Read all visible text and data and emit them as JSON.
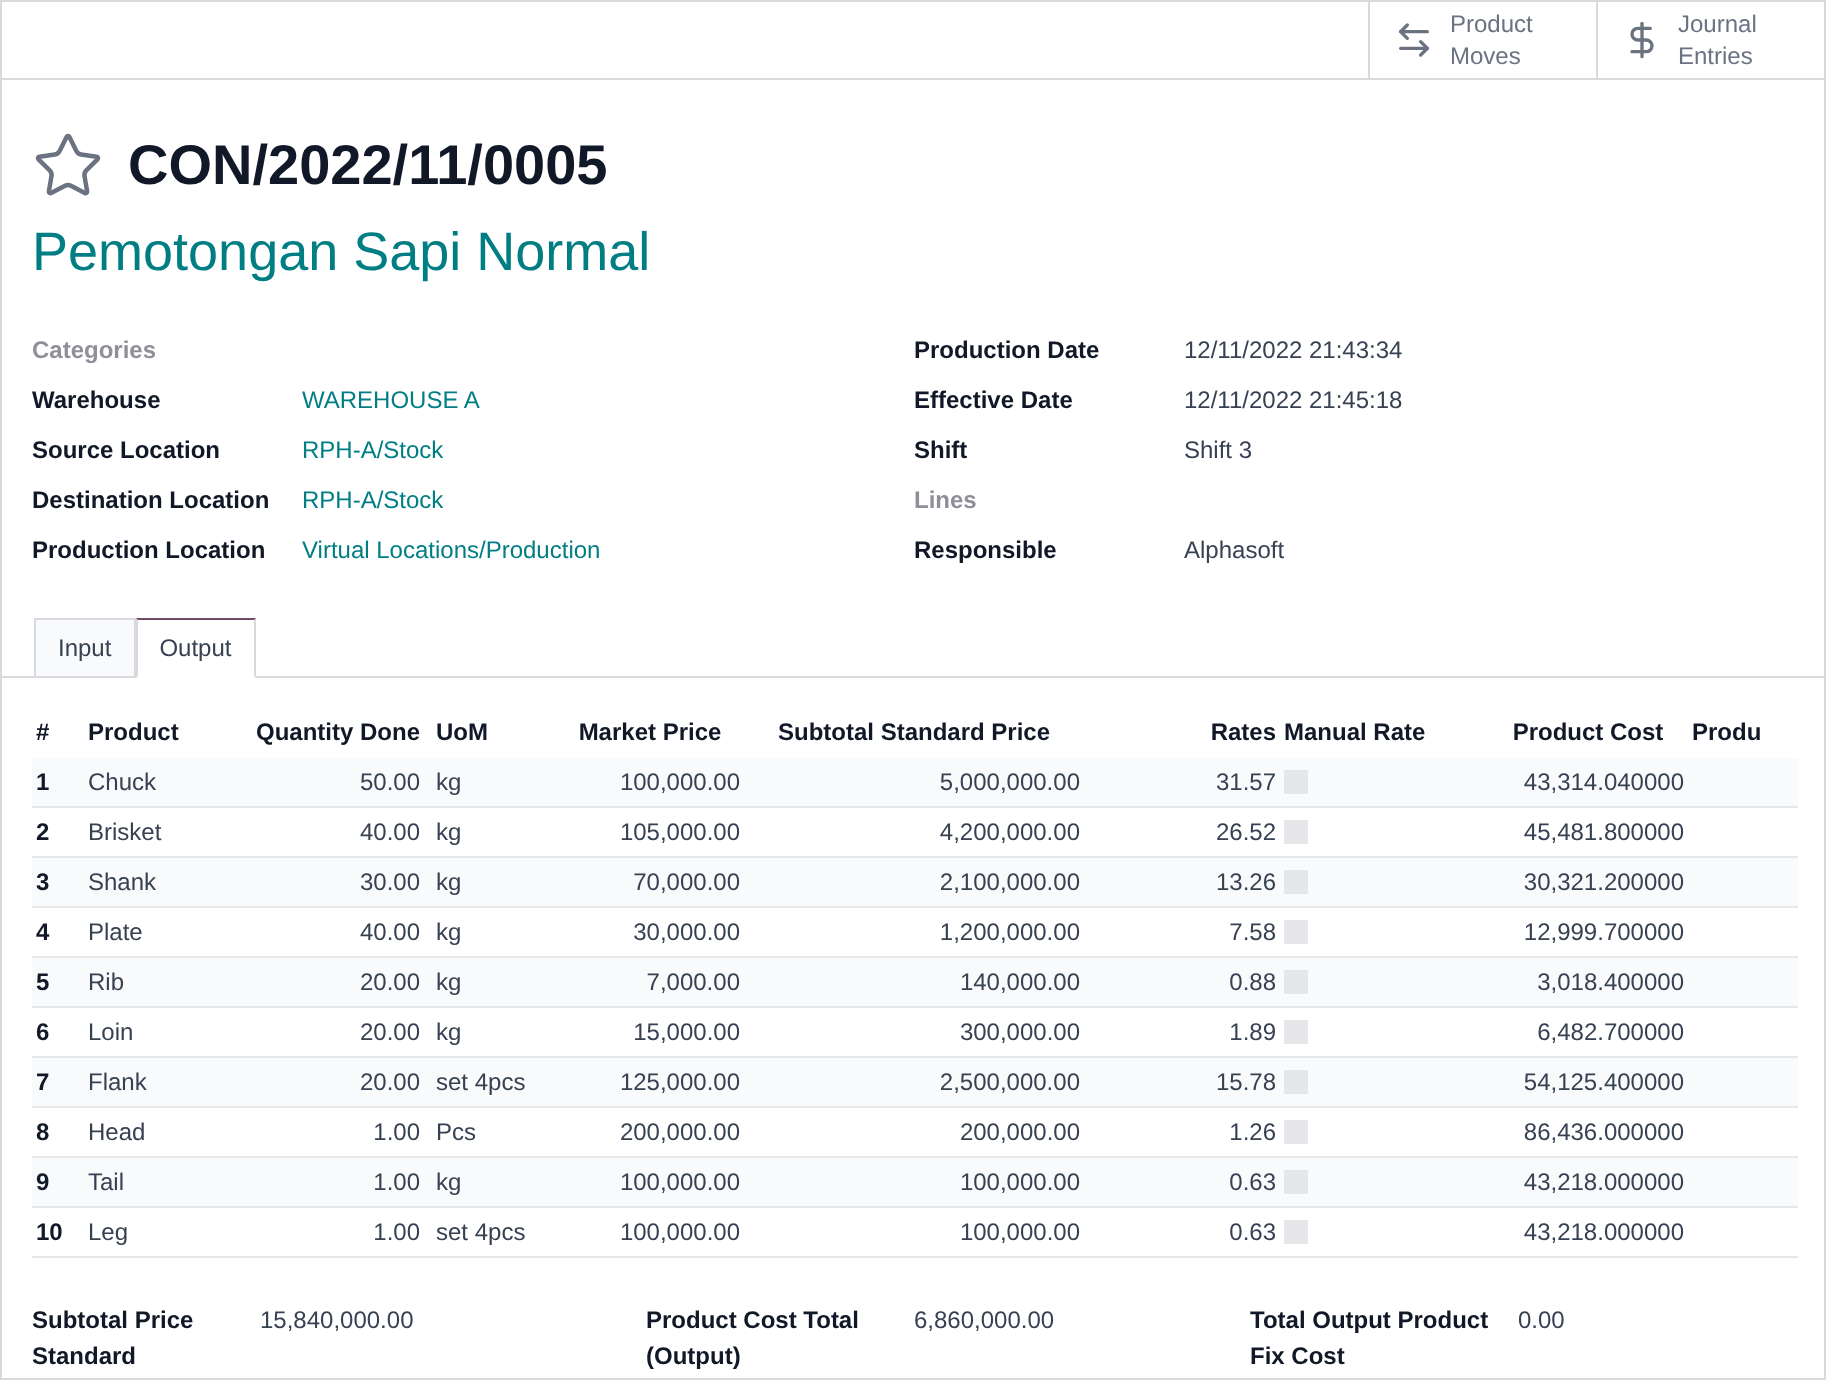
{
  "smart_buttons": [
    {
      "kind": "moves",
      "label": "Product Moves"
    },
    {
      "kind": "journal",
      "label": "Journal Entries"
    }
  ],
  "favorite": false,
  "reference": "CON/2022/11/0005",
  "name": "Pemotongan Sapi Normal",
  "left_fields": [
    {
      "label": "Categories",
      "empty": true
    },
    {
      "label": "Warehouse",
      "value": "WAREHOUSE A",
      "empty": false
    },
    {
      "label": "Source Location",
      "value": "RPH-A/Stock",
      "empty": false
    },
    {
      "label": "Destination Location",
      "value": "RPH-A/Stock",
      "empty": false
    },
    {
      "label": "Production Location",
      "value": "Virtual Locations/Production",
      "empty": false
    }
  ],
  "right_fields": [
    {
      "label": "Production Date",
      "value": "12/11/2022 21:43:34",
      "empty": false
    },
    {
      "label": "Effective Date",
      "value": "12/11/2022 21:45:18",
      "empty": false
    },
    {
      "label": "Shift",
      "value": "Shift 3",
      "empty": false
    },
    {
      "label": "Lines",
      "empty": true
    },
    {
      "label": "Responsible",
      "value": "Alphasoft",
      "empty": false
    }
  ],
  "tabs": [
    {
      "label": "Input",
      "selected": false
    },
    {
      "label": "Output",
      "selected": true
    }
  ],
  "table": {
    "columns": [
      "#",
      "Product",
      "Quantity Done",
      "UoM",
      "Market Price",
      "Subtotal Standard Price",
      "Rates",
      "Manual Rate",
      "Product Cost",
      "Produ"
    ],
    "rows": [
      {
        "no": "1",
        "product": "Chuck",
        "qty": "50.00",
        "uom": "kg",
        "market": "100,000.00",
        "subtotal": "5,000,000.00",
        "rate": "31.57",
        "manual": false,
        "cost": "43,314.040000"
      },
      {
        "no": "2",
        "product": "Brisket",
        "qty": "40.00",
        "uom": "kg",
        "market": "105,000.00",
        "subtotal": "4,200,000.00",
        "rate": "26.52",
        "manual": false,
        "cost": "45,481.800000"
      },
      {
        "no": "3",
        "product": "Shank",
        "qty": "30.00",
        "uom": "kg",
        "market": "70,000.00",
        "subtotal": "2,100,000.00",
        "rate": "13.26",
        "manual": false,
        "cost": "30,321.200000"
      },
      {
        "no": "4",
        "product": "Plate",
        "qty": "40.00",
        "uom": "kg",
        "market": "30,000.00",
        "subtotal": "1,200,000.00",
        "rate": "7.58",
        "manual": false,
        "cost": "12,999.700000"
      },
      {
        "no": "5",
        "product": "Rib",
        "qty": "20.00",
        "uom": "kg",
        "market": "7,000.00",
        "subtotal": "140,000.00",
        "rate": "0.88",
        "manual": false,
        "cost": "3,018.400000"
      },
      {
        "no": "6",
        "product": "Loin",
        "qty": "20.00",
        "uom": "kg",
        "market": "15,000.00",
        "subtotal": "300,000.00",
        "rate": "1.89",
        "manual": false,
        "cost": "6,482.700000"
      },
      {
        "no": "7",
        "product": "Flank",
        "qty": "20.00",
        "uom": "set 4pcs",
        "market": "125,000.00",
        "subtotal": "2,500,000.00",
        "rate": "15.78",
        "manual": false,
        "cost": "54,125.400000"
      },
      {
        "no": "8",
        "product": "Head",
        "qty": "1.00",
        "uom": "Pcs",
        "market": "200,000.00",
        "subtotal": "200,000.00",
        "rate": "1.26",
        "manual": false,
        "cost": "86,436.000000"
      },
      {
        "no": "9",
        "product": "Tail",
        "qty": "1.00",
        "uom": "kg",
        "market": "100,000.00",
        "subtotal": "100,000.00",
        "rate": "0.63",
        "manual": false,
        "cost": "43,218.000000"
      },
      {
        "no": "10",
        "product": "Leg",
        "qty": "1.00",
        "uom": "set 4pcs",
        "market": "100,000.00",
        "subtotal": "100,000.00",
        "rate": "0.63",
        "manual": false,
        "cost": "43,218.000000"
      }
    ]
  },
  "totals": [
    {
      "label": "Subtotal Price Standard",
      "value": "15,840,000.00"
    },
    {
      "label": "Product Cost Total (Output)",
      "value": "6,860,000.00"
    },
    {
      "label": "Total Output Product Fix Cost",
      "value": "0.00"
    }
  ]
}
